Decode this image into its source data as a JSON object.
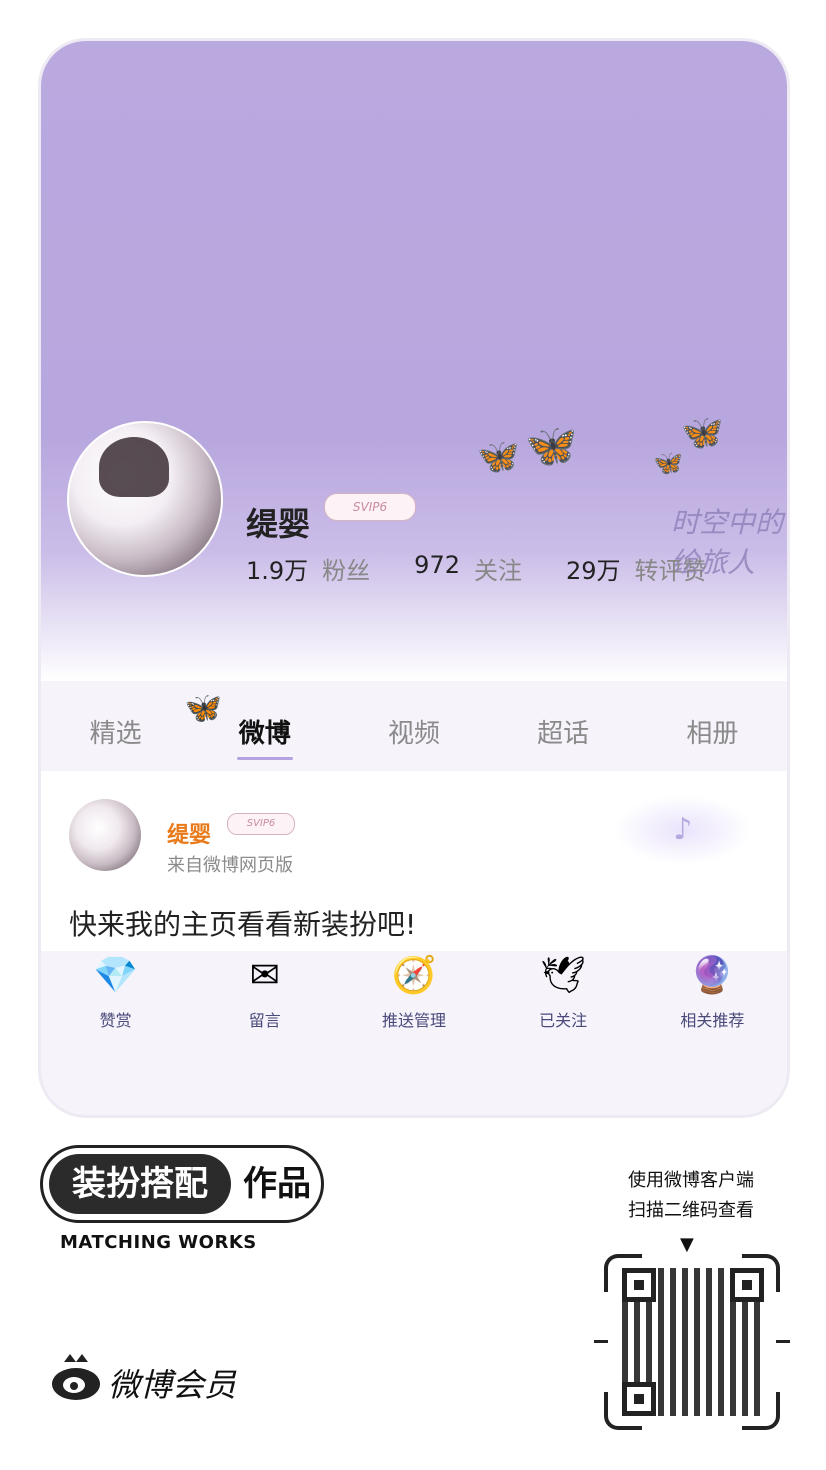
{
  "profile": {
    "name": "缇婴",
    "badge": "SVIP6",
    "stats": [
      {
        "num": "1.9万",
        "label": "粉丝"
      },
      {
        "num": "972",
        "label": "关注"
      },
      {
        "num": "29万",
        "label": "转评赞"
      }
    ],
    "watermark": "时空中的绘旅人"
  },
  "tabs": [
    "精选",
    "微博",
    "视频",
    "超话",
    "相册"
  ],
  "active_tab": "微博",
  "post": {
    "name": "缇婴",
    "badge": "SVIP6",
    "source": "来自微博网页版",
    "text": "快来我的主页看看新装扮吧!"
  },
  "actions": [
    {
      "label": "赞赏",
      "icon": "diamond-icon"
    },
    {
      "label": "留言",
      "icon": "envelope-icon"
    },
    {
      "label": "推送管理",
      "icon": "compass-icon"
    },
    {
      "label": "已关注",
      "icon": "paper-crane-icon"
    },
    {
      "label": "相关推荐",
      "icon": "orb-wand-icon"
    }
  ],
  "footer": {
    "badge_dark": "装扮搭配",
    "badge_light": "作品",
    "badge_sub": "MATCHING WORKS",
    "brand": "微博会员",
    "qr_hint_line1": "使用微博客户端",
    "qr_hint_line2": "扫描二维码查看"
  },
  "colors": {
    "banner": "#b9a9df",
    "accent_orange": "#e87a1a",
    "tab_underline": "#b4a3e0"
  }
}
